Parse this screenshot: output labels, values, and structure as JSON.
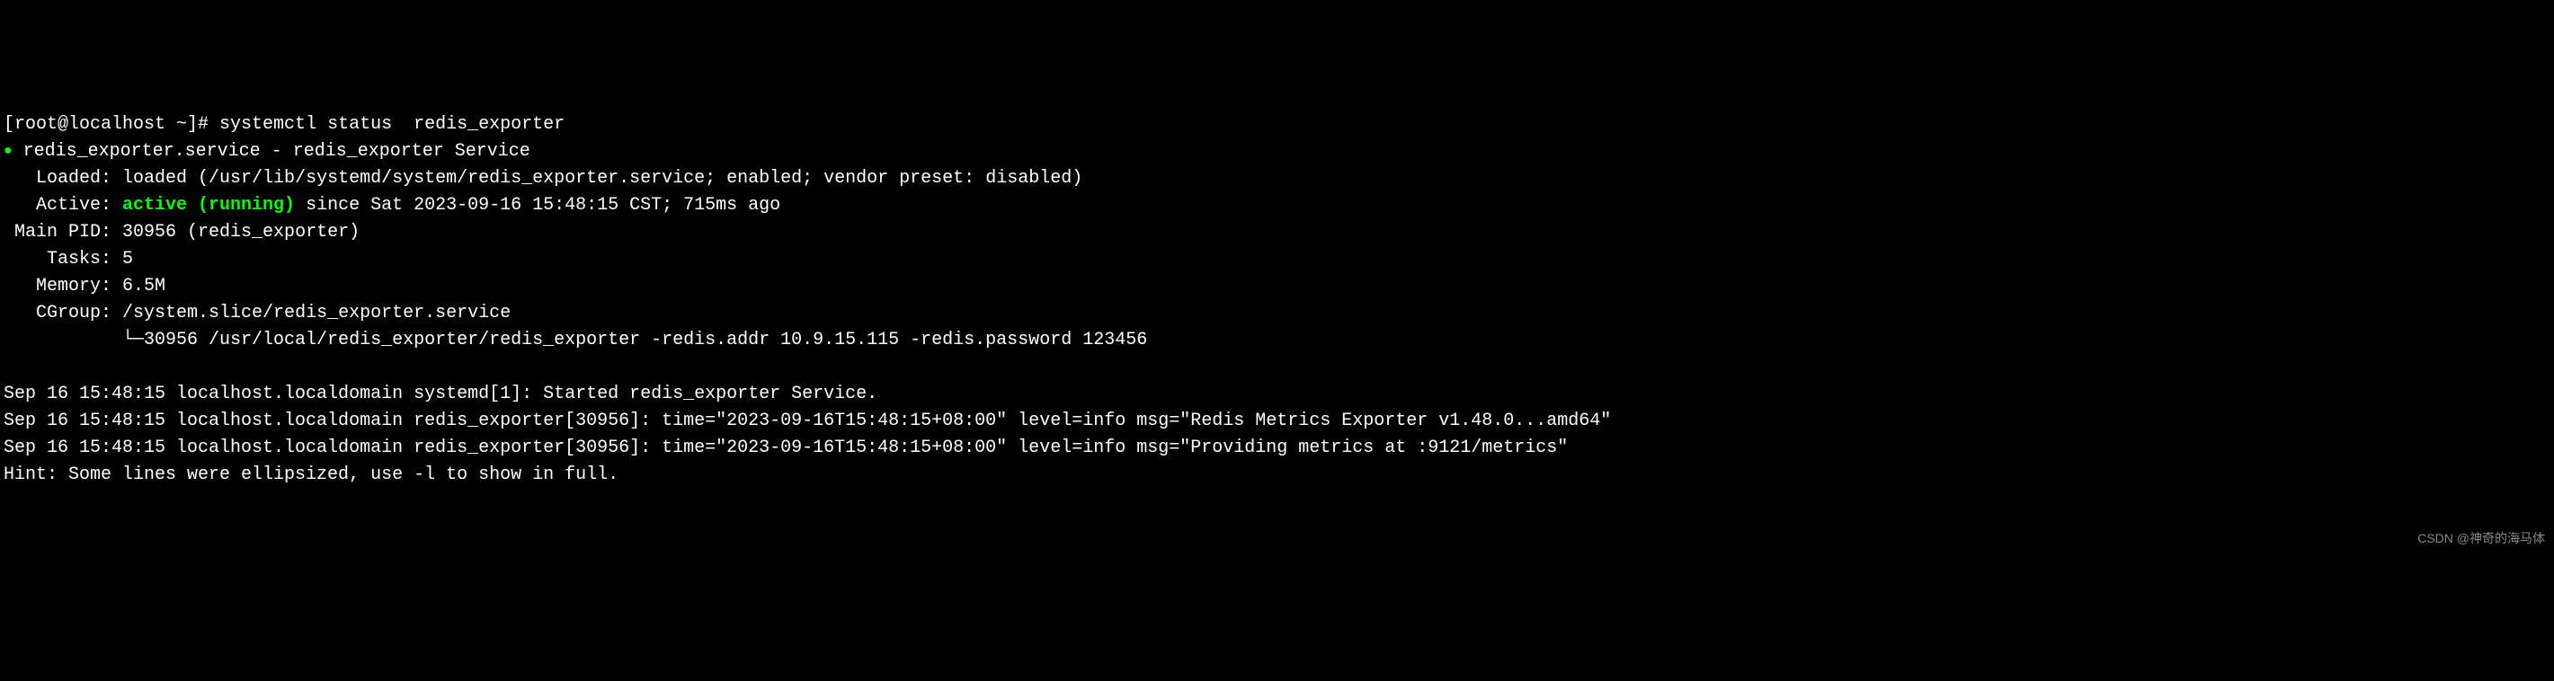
{
  "prompt": {
    "user_host": "[root@localhost ~]# ",
    "command": "systemctl status  redis_exporter"
  },
  "service": {
    "unit_name": "redis_exporter.service",
    "separator": " - ",
    "description": "redis_exporter Service"
  },
  "loaded": {
    "label": "   Loaded: ",
    "value": "loaded (/usr/lib/systemd/system/redis_exporter.service; enabled; vendor preset: disabled)"
  },
  "active": {
    "label": "   Active: ",
    "status": "active (running)",
    "since": " since Sat 2023-09-16 15:48:15 CST; 715ms ago"
  },
  "main_pid": {
    "label": " Main PID: ",
    "value": "30956 (redis_exporter)"
  },
  "tasks": {
    "label": "    Tasks: ",
    "value": "5"
  },
  "memory": {
    "label": "   Memory: ",
    "value": "6.5M"
  },
  "cgroup": {
    "label": "   CGroup: ",
    "value": "/system.slice/redis_exporter.service"
  },
  "process": {
    "tree": "           └─30956 /usr/local/redis_exporter/redis_exporter -redis.addr 10.9.15.115 -redis.password 123456"
  },
  "logs": {
    "line1": "Sep 16 15:48:15 localhost.localdomain systemd[1]: Started redis_exporter Service.",
    "line2": "Sep 16 15:48:15 localhost.localdomain redis_exporter[30956]: time=\"2023-09-16T15:48:15+08:00\" level=info msg=\"Redis Metrics Exporter v1.48.0...amd64\"",
    "line3": "Sep 16 15:48:15 localhost.localdomain redis_exporter[30956]: time=\"2023-09-16T15:48:15+08:00\" level=info msg=\"Providing metrics at :9121/metrics\""
  },
  "hint": "Hint: Some lines were ellipsized, use -l to show in full.",
  "watermark": "CSDN @神奇的海马体"
}
